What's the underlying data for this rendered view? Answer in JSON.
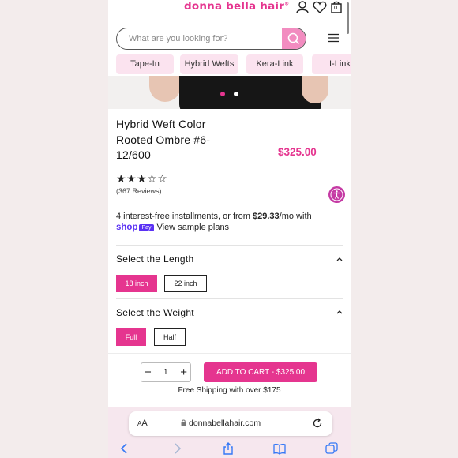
{
  "header": {
    "logo_text": "donna bella hair",
    "logo_mark": "®",
    "cart_count": "0"
  },
  "search": {
    "placeholder": "What are you looking for?"
  },
  "categories": [
    "Tape-In",
    "Hybrid Wefts",
    "Kera-Link",
    "I-Link"
  ],
  "product": {
    "title": "Hybrid Weft Color Rooted Ombre #6-12/600",
    "price": "$325.00",
    "rating": 3.5,
    "stars_text": "★★★☆☆",
    "reviews": "(367 Reviews)"
  },
  "payment": {
    "installments_prefix": "4 interest-free installments, or from ",
    "installments_amount": "$29.33",
    "installments_suffix": "/mo with",
    "shop_logo": "shop",
    "pay_badge": "Pay",
    "sample_link": "View sample plans"
  },
  "length": {
    "title": "Select the Length",
    "options": [
      "18 inch",
      "22 inch"
    ],
    "selected": "18 inch"
  },
  "weight": {
    "title": "Select the Weight",
    "options": [
      "Full",
      "Half"
    ],
    "selected": "Full"
  },
  "cart": {
    "quantity": "1",
    "minus": "−",
    "plus": "+",
    "add_button": "ADD TO CART - $325.00",
    "shipping": "Free Shipping with over $175"
  },
  "browser": {
    "aa_small": "A",
    "aa_large": "A",
    "url": "donnabellahair.com"
  },
  "colors": {
    "brand_pink": "#e5358f",
    "chip_pink": "#fbe3ef",
    "search_button": "#f28cc0",
    "shop_pay": "#5a31f4",
    "accessibility": "#c53aa4"
  },
  "icons": {
    "header": [
      "account-icon",
      "heart-icon",
      "cart-icon"
    ],
    "browser_toolbar": [
      "back-icon",
      "forward-icon",
      "share-icon",
      "bookmarks-icon",
      "tabs-icon"
    ]
  },
  "carousel": {
    "slide_count": 2,
    "active_index": 0
  }
}
